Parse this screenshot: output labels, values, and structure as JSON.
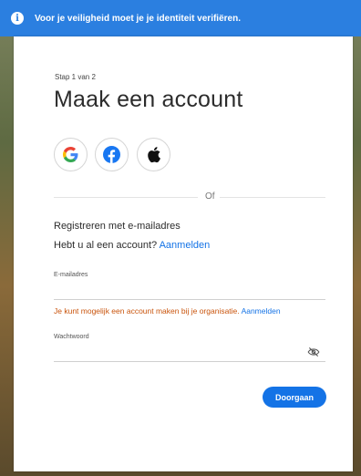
{
  "banner": {
    "text": "Voor je veiligheid moet je je identiteit verifiëren.",
    "icon": "info-icon"
  },
  "form": {
    "step": "Stap 1 van 2",
    "title": "Maak een account",
    "social": [
      {
        "name": "google",
        "icon": "google-icon"
      },
      {
        "name": "facebook",
        "icon": "facebook-icon"
      },
      {
        "name": "apple",
        "icon": "apple-icon"
      }
    ],
    "or_text": "Of",
    "register_heading": "Registreren met e-mailadres",
    "have_account_text": "Hebt u al een account?",
    "sign_in_link": "Aanmelden",
    "email_label": "E-mailadres",
    "email_value": "",
    "org_note_text": "Je kunt mogelijk een account maken bij je organisatie.",
    "org_note_link": "Aanmelden",
    "password_label": "Wachtwoord",
    "password_value": "",
    "continue_label": "Doorgaan"
  },
  "colors": {
    "accent": "#1473e6",
    "banner": "#2b7fe0",
    "warning": "#c9540c"
  }
}
